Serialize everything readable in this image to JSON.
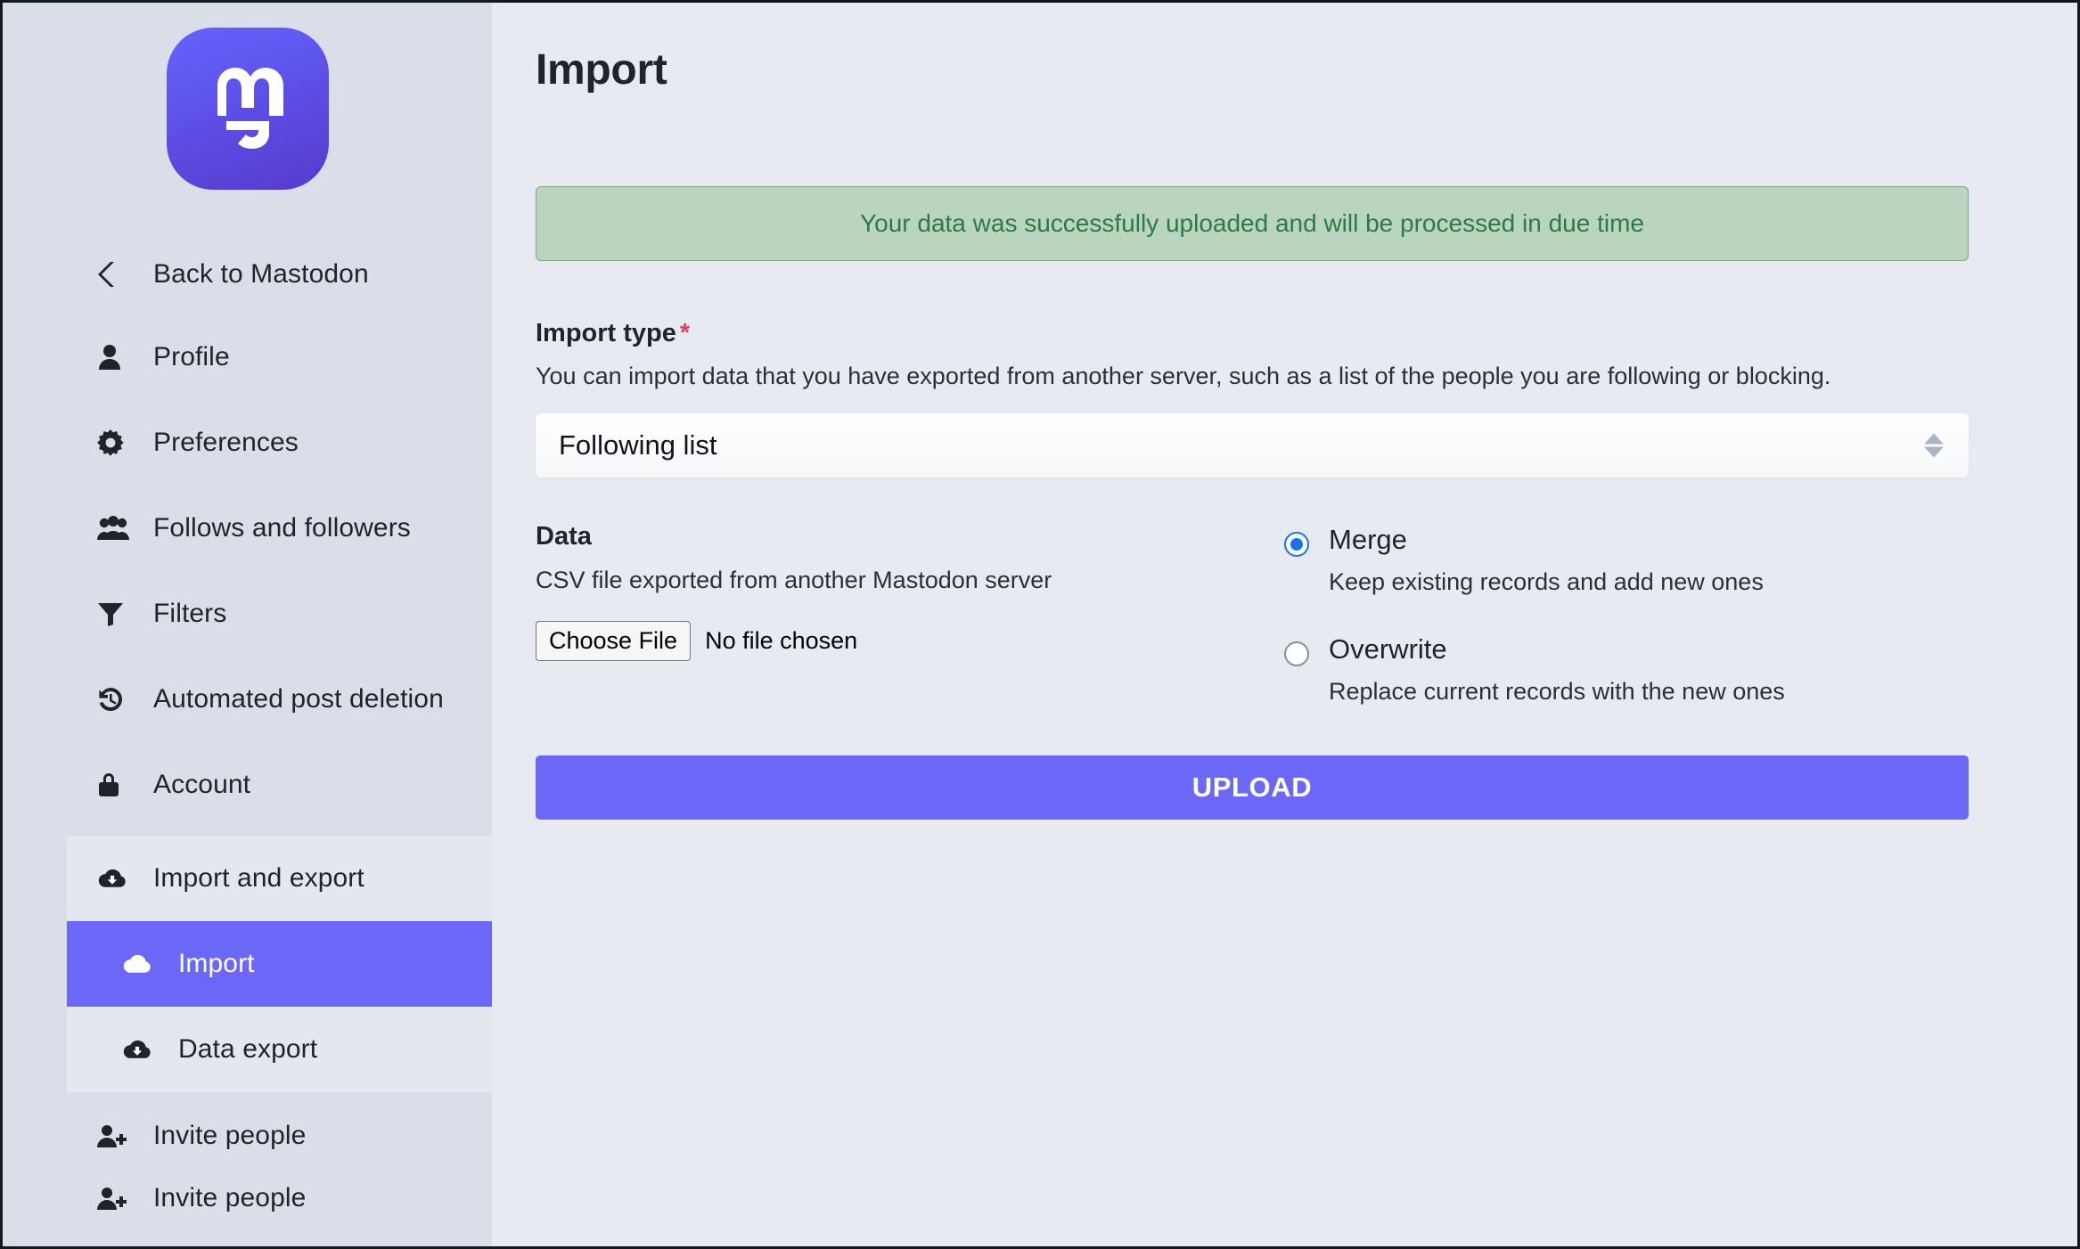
{
  "sidebar": {
    "logo_alt": "mastodon-logo",
    "back": {
      "label": "Back to Mastodon",
      "icon": "chevron-left-icon"
    },
    "items": [
      {
        "label": "Profile",
        "icon": "user-icon"
      },
      {
        "label": "Preferences",
        "icon": "gear-icon"
      },
      {
        "label": "Follows and followers",
        "icon": "users-icon"
      },
      {
        "label": "Filters",
        "icon": "filter-icon"
      },
      {
        "label": "Automated post deletion",
        "icon": "history-icon"
      },
      {
        "label": "Account",
        "icon": "lock-icon"
      }
    ],
    "group": {
      "label": "Import and export",
      "icon": "cloud-download-icon",
      "children": [
        {
          "label": "Import",
          "icon": "cloud-upload-icon",
          "active": true
        },
        {
          "label": "Data export",
          "icon": "cloud-download-icon",
          "active": false
        }
      ]
    },
    "bottom_items": [
      {
        "label": "Invite people",
        "icon": "user-plus-icon"
      },
      {
        "label": "Invite people",
        "icon": "user-plus-icon"
      }
    ]
  },
  "main": {
    "title": "Import",
    "flash": "Your data was successfully uploaded and will be processed in due time",
    "import_type": {
      "label": "Import type",
      "required_marker": "*",
      "hint": "You can import data that you have exported from another server, such as a list of the people you are following or blocking.",
      "selected": "Following list"
    },
    "data": {
      "label": "Data",
      "hint": "CSV file exported from another Mastodon server",
      "choose_button": "Choose File",
      "file_status": "No file chosen"
    },
    "modes": [
      {
        "label": "Merge",
        "desc": "Keep existing records and add new ones",
        "checked": true
      },
      {
        "label": "Overwrite",
        "desc": "Replace current records with the new ones",
        "checked": false
      }
    ],
    "upload_button": "UPLOAD"
  },
  "colors": {
    "accent": "#6b68f7",
    "sidebar_bg": "#d9dee8",
    "main_bg": "#e7eaf1",
    "flash_bg": "#b9d4bf",
    "flash_text": "#2d7a47",
    "required": "#df405a",
    "radio_selected": "#1a73e8"
  }
}
